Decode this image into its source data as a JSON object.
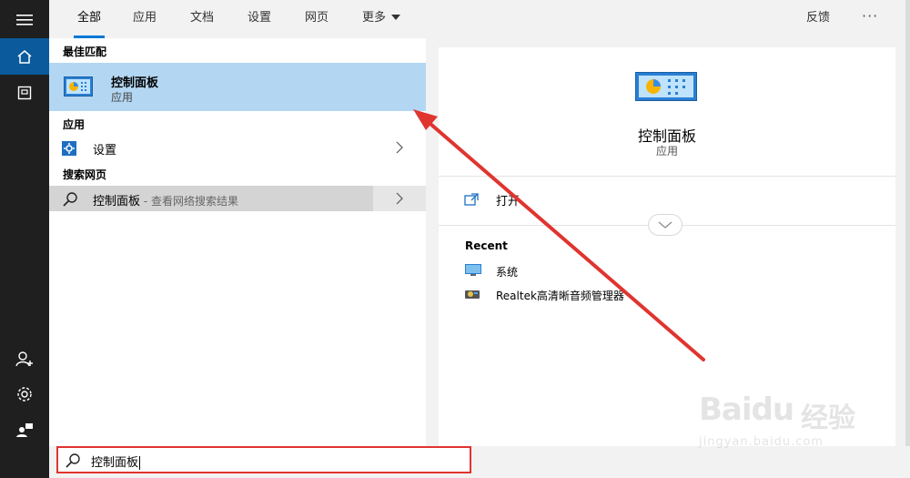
{
  "nav": {
    "tabs": [
      {
        "label": "全部",
        "active": true
      },
      {
        "label": "应用"
      },
      {
        "label": "文档"
      },
      {
        "label": "设置"
      },
      {
        "label": "网页"
      },
      {
        "label": "更多"
      }
    ],
    "feedback_label": "反馈",
    "more_options": "···"
  },
  "results": {
    "best_match_header": "最佳匹配",
    "best_match": {
      "title": "控制面板",
      "subtitle": "应用",
      "icon": "control-panel-icon"
    },
    "apps_header": "应用",
    "apps": [
      {
        "label": "设置",
        "icon": "settings-gear-icon"
      }
    ],
    "web_header": "搜索网页",
    "web": [
      {
        "label": "控制面板",
        "suffix": " - 查看网络搜索结果",
        "icon": "search-icon"
      }
    ]
  },
  "preview": {
    "title": "控制面板",
    "subtitle": "应用",
    "open_label": "打开",
    "recent_header": "Recent",
    "recent": [
      {
        "label": "系统",
        "icon": "system-monitor-icon"
      },
      {
        "label": "Realtek高清晰音频管理器",
        "icon": "realtek-audio-icon"
      }
    ]
  },
  "search": {
    "query": "控制面板"
  },
  "watermark": {
    "brand": "Baidu",
    "brand_cn": "经验",
    "url": "jingyan.baidu.com"
  },
  "colors": {
    "accent": "#0078d7",
    "rail_bg": "#1f1f1f",
    "rail_active": "#0a5a9c",
    "selected_bg": "#b3d7f3",
    "annotation_red": "#e0342f"
  }
}
